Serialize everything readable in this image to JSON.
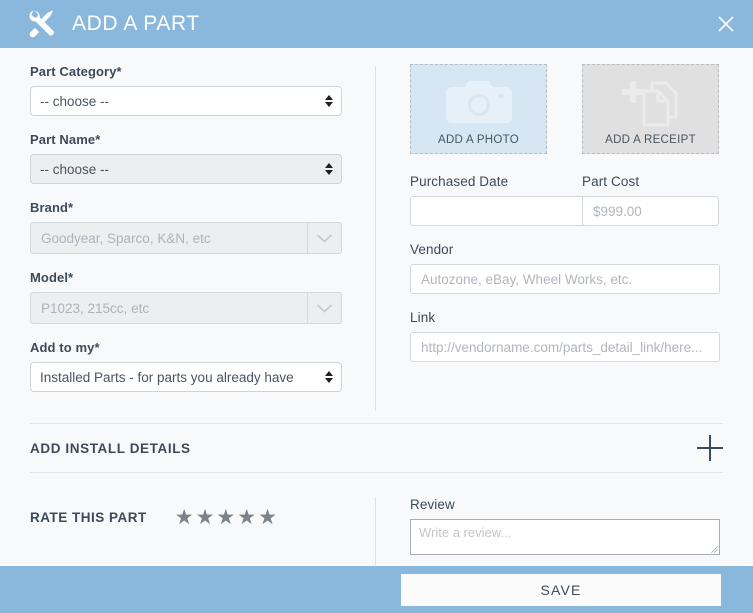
{
  "header": {
    "title": "ADD A PART",
    "icon": "tools-icon",
    "close_icon": "close-icon",
    "background": "#8ab8dd"
  },
  "form": {
    "part_category": {
      "label": "Part Category*",
      "value": "-- choose --",
      "state": "enabled"
    },
    "part_name": {
      "label": "Part Name*",
      "value": "-- choose --",
      "state": "disabled"
    },
    "brand": {
      "label": "Brand*",
      "placeholder": "Goodyear, Sparco, K&N, etc",
      "value": ""
    },
    "model": {
      "label": "Model*",
      "placeholder": "P1023, 215cc, etc",
      "value": ""
    },
    "add_to_my": {
      "label": "Add to my*",
      "value": "Installed Parts - for parts you already have"
    }
  },
  "uploads": [
    {
      "caption": "ADD A PHOTO",
      "icon": "camera-icon",
      "background": "#d7e6f3"
    },
    {
      "caption": "ADD A RECEIPT",
      "icon": "documents-plus-icon",
      "background": "#e0e0e0"
    }
  ],
  "details": {
    "purchased_date": {
      "label": "Purchased Date",
      "value": "",
      "placeholder": "",
      "icon": "calendar-icon"
    },
    "part_cost": {
      "label": "Part Cost",
      "placeholder": "$999.00",
      "value": ""
    },
    "vendor": {
      "label": "Vendor",
      "placeholder": "Autozone, eBay, Wheel Works, etc.",
      "value": ""
    },
    "link": {
      "label": "Link",
      "placeholder": "http://vendorname.com/parts_detail_link/here...",
      "value": ""
    }
  },
  "install_section": {
    "label": "ADD INSTALL DETAILS",
    "expand_icon": "plus-icon"
  },
  "rating": {
    "label": "RATE THIS PART",
    "max_stars": 5,
    "value": 0,
    "star_color": "#7c8289"
  },
  "review": {
    "label": "Review",
    "placeholder": "Write a review...",
    "value": ""
  },
  "footer": {
    "save_label": "SAVE",
    "background": "#8ab8dd"
  }
}
